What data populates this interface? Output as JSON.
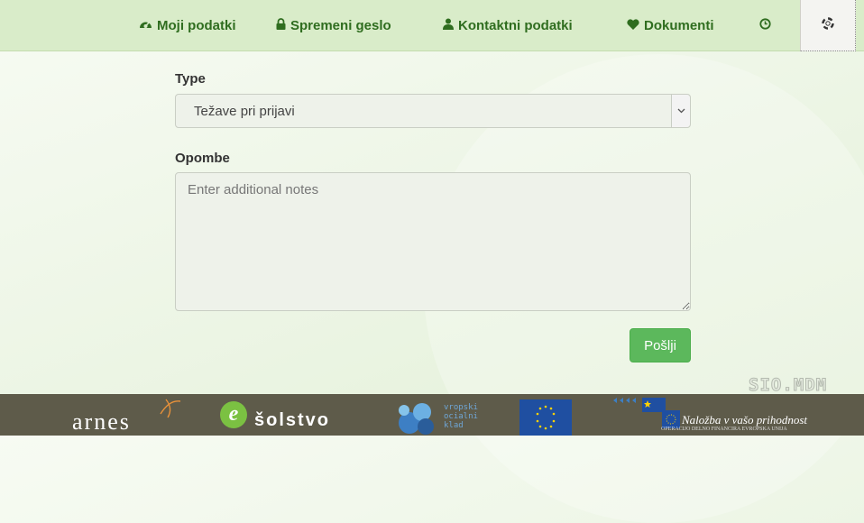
{
  "nav": {
    "items": [
      {
        "label": "Moji podatki",
        "icon": "dashboard-icon"
      },
      {
        "label": "Spremeni geslo",
        "icon": "lock-icon"
      },
      {
        "label": "Kontaktni podatki",
        "icon": "user-icon"
      },
      {
        "label": "Dokumenti",
        "icon": "heart-icon"
      }
    ],
    "history_icon": "clock-icon",
    "help_icon": "life-ring-icon"
  },
  "form": {
    "type_label": "Type",
    "type_value": "Težave pri prijavi",
    "notes_label": "Opombe",
    "notes_placeholder": "Enter additional notes",
    "submit_label": "Pošlji"
  },
  "watermark": "SIO.MDM",
  "footer": {
    "arnes": "arnes",
    "solstvo_letter": "e",
    "solstvo": "šolstvo",
    "esf_line1": "vropski",
    "esf_line2": "ocialni",
    "esf_line3": "klad",
    "nalozba": "Naložba v vašo prihodnost",
    "nalozba_sub": "OPERACIJO DELNO FINANCIRA EVROPSKA UNIJA"
  },
  "colors": {
    "nav_bg": "#d9ecc9",
    "nav_text": "#2f6d1f",
    "button_green": "#5cb85c",
    "footer_bg": "#5e5b4a"
  }
}
